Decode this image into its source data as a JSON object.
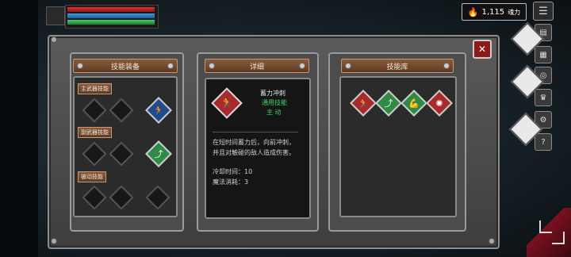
{
  "currency": {
    "icon": "flame-icon",
    "amount": "1,115",
    "unit": "魂力"
  },
  "hud": {
    "hp": 1.0,
    "mp": 1.0,
    "xp": 1.0
  },
  "panels": {
    "equip": {
      "title": "技能装备",
      "main_weapon_label": "主武器技能",
      "sub_weapon_label": "副武器技能",
      "passive_label": "被动技能",
      "main_skill_icon": "dash-kick-icon",
      "sub_skill_icon": "leap-icon"
    },
    "detail": {
      "title": "详细",
      "skill_name": "蓄力冲刺",
      "skill_type": "通用技能",
      "skill_mode": "主 动",
      "desc_line1": "在短时间蓄力后，向前冲刺，",
      "desc_line2": "并且对触碰的敌人造成伤害。",
      "cooldown": "冷却时间：10",
      "mana_cost": "魔法消耗：3"
    },
    "library": {
      "title": "技能库",
      "skills": [
        {
          "name": "charge-dash-icon",
          "color": "#a92a2a"
        },
        {
          "name": "sprint-icon",
          "color": "#2f8a45"
        },
        {
          "name": "flex-icon",
          "color": "#2f8a45"
        },
        {
          "name": "shockwave-icon",
          "color": "#a92a2a"
        }
      ]
    }
  }
}
